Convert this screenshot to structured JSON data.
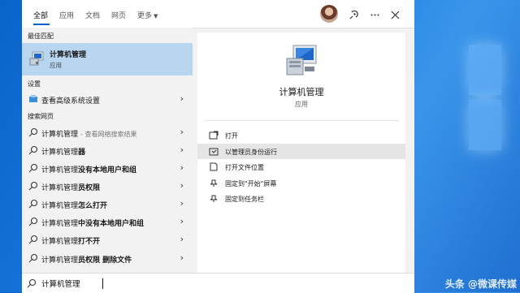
{
  "tabs": [
    {
      "label": "全部",
      "active": true
    },
    {
      "label": "应用"
    },
    {
      "label": "文档"
    },
    {
      "label": "网页"
    },
    {
      "label": "更多"
    }
  ],
  "top_icons": [
    "avatar",
    "feedback-icon",
    "more-icon",
    "close-icon"
  ],
  "left": {
    "best_match_label": "最佳匹配",
    "best_match": {
      "title": "计算机管理",
      "subtitle": "应用",
      "icon": "computer-management-icon"
    },
    "settings_label": "设置",
    "settings_item": {
      "label": "查看高级系统设置",
      "icon": "settings-icon"
    },
    "web_label": "搜索网页",
    "web_items": [
      {
        "prefix": "计算机管理",
        "bold": "",
        "hint": "- 查看网络搜索结果"
      },
      {
        "prefix": "计算机管理",
        "bold": "器",
        "hint": ""
      },
      {
        "prefix": "计算机管理",
        "bold": "没有本地用户和组",
        "hint": ""
      },
      {
        "prefix": "计算机管理",
        "bold": "员权限",
        "hint": ""
      },
      {
        "prefix": "计算机管理",
        "bold": "怎么打开",
        "hint": ""
      },
      {
        "prefix": "计算机管理",
        "bold": "中没有本地用户和组",
        "hint": ""
      },
      {
        "prefix": "计算机管理",
        "bold": "打不开",
        "hint": ""
      },
      {
        "prefix": "计算机管理",
        "bold": "员权限 删除文件",
        "hint": ""
      }
    ]
  },
  "right": {
    "title": "计算机管理",
    "subtitle": "应用",
    "actions": [
      {
        "label": "打开",
        "icon": "open-icon"
      },
      {
        "label": "以管理员身份运行",
        "icon": "run-as-admin-icon",
        "highlighted": true
      },
      {
        "label": "打开文件位置",
        "icon": "file-location-icon"
      },
      {
        "label": "固定到\"开始\"屏幕",
        "icon": "pin-start-icon"
      },
      {
        "label": "固定到任务栏",
        "icon": "pin-taskbar-icon"
      }
    ]
  },
  "search": {
    "value": "计算机管理",
    "icon": "search-icon"
  },
  "watermark": "头条 @微课传媒",
  "colors": {
    "accent": "#0a64c8",
    "selected": "#b9d6f0",
    "hover": "#e5e5e5",
    "desktop": "#1b78dc"
  }
}
